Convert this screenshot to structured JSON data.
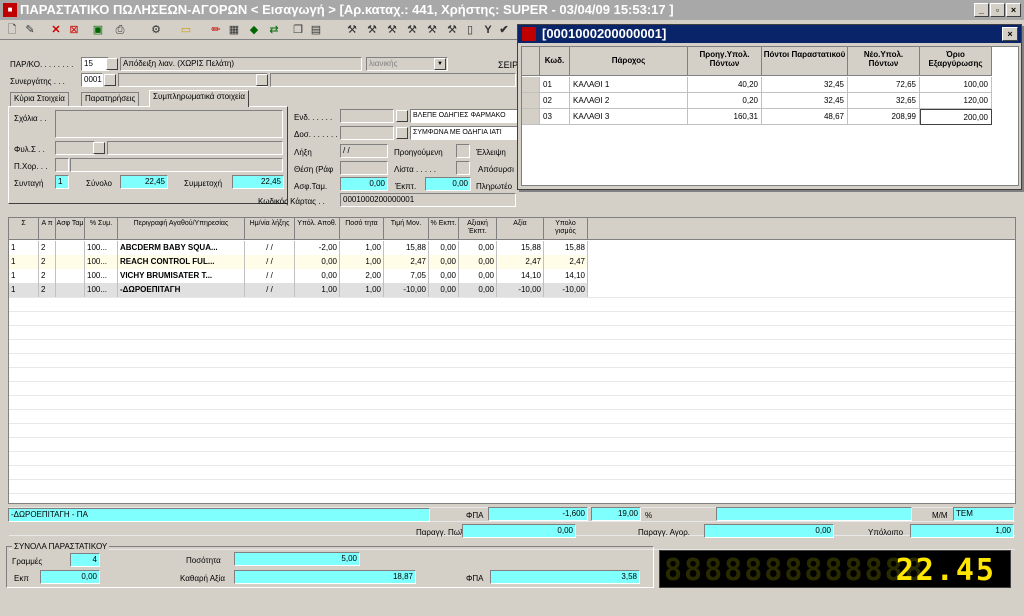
{
  "window": {
    "title": "ΠΑΡΑΣΤΑΤΙΚΟ ΠΩΛΗΣΕΩΝ-ΑΓΟΡΩΝ < Εισαγωγή > [Αρ.καταχ.: 441, Χρήστης: SUPER - 03/04/09 15:53:17 ]"
  },
  "toolbar": {
    "icons": [
      "new-icon",
      "open-icon",
      "delete-icon",
      "cancel-icon",
      "save-icon",
      "print-icon",
      "tools-icon",
      "folder-icon",
      "edit-icon",
      "calc-icon",
      "money-icon",
      "transfer-icon",
      "copy-icon",
      "calc2-icon",
      "hammer-icon",
      "check-icon"
    ],
    "y_label": "Y"
  },
  "header": {
    "par_label": "ΠΑΡ/ΚΟ. . . . . . . .",
    "par_code": "15",
    "par_desc": "Απόδειξη λιαν. (ΧΩΡΙΣ Πελάτη)",
    "par_type": "λιανικής",
    "partner_label": "Συνεργάτης . . .",
    "partner_code": "0001",
    "seira_label": "ΣΕΙΡΑ"
  },
  "tabs": [
    "Κύρια Στοιχεία",
    "Παρατηρήσεις",
    "Συμπληρωματικά στοιχεία"
  ],
  "left_panel": {
    "sxolia": "Σχόλια . .",
    "fyl": "Φυλ.Σ . .",
    "pxor": "Π.Χορ. . .",
    "syntagi_label": "Συνταγή",
    "syntagi": "1",
    "synolo_label": "Σύνολο",
    "synolo": "22,45",
    "symmetoxi_label": "Συμμετοχή",
    "symmetoxi": "22,45"
  },
  "mid_panel": {
    "end_label": "Ενδ. . . . . .",
    "end_text": "ΒΛΕΠΕ ΟΔΗΓΙΕΣ ΦΑΡΜΑΚΟ",
    "dos_label": "Δοσ. . . . . . .",
    "dos_text": "ΣΥΜΦΩΝΑ ΜΕ ΟΔΗΓΙΑ ΙΑΤΙ",
    "lixi_label": "Λήξη",
    "lixi": " / / ",
    "thesi_label": "Θέση (Ράφ",
    "asf_label": "Ασφ.Ταμ.",
    "asf": "0,00",
    "ekpt_label": "Έκπτ.",
    "ekpt": "0,00",
    "prog_label": "Προηγούμενη",
    "lista_label": "Λίστα . . . . .",
    "elleipsi_label": "Έλλειψη",
    "aposyrsi_label": "Απόσυρσι",
    "pliroteo_label": "Πληρωτέο",
    "card_label": "Κωδικός Κάρτας . .",
    "card": "0001000200000001"
  },
  "grid": {
    "headers": [
      "Σ",
      "Α π",
      "Ασφ Ταμ",
      "% Συμ.",
      "Περιγραφή Αγαθού/Υπηρεσίας",
      "Ημ/νία λήξης",
      "Υπόλ. Αποθ.",
      "Ποσό τητα",
      "Τιμή Μον.",
      "% Εκπτ.",
      "Αξιακή Έκπτ.",
      "Αξία",
      "Υπολο γισμός"
    ],
    "rows": [
      [
        "1",
        "2",
        "",
        "100...",
        "ABCDERM BABY SQUA...",
        "/ /",
        "-2,00",
        "1,00",
        "15,88",
        "0,00",
        "0,00",
        "15,88",
        "15,88"
      ],
      [
        "1",
        "2",
        "",
        "100...",
        "REACH CONTROL FUL...",
        "/ /",
        "0,00",
        "1,00",
        "2,47",
        "0,00",
        "0,00",
        "2,47",
        "2,47"
      ],
      [
        "1",
        "2",
        "",
        "100...",
        "VICHY BRUMISATER T...",
        "/ /",
        "0,00",
        "2,00",
        "7,05",
        "0,00",
        "0,00",
        "14,10",
        "14,10"
      ],
      [
        "1",
        "2",
        "",
        "100...",
        "-ΔΩΡΟΕΠΙΤΑΓΗ",
        "/ /",
        "1,00",
        "1,00",
        "-10,00",
        "0,00",
        "0,00",
        "-10,00",
        "-10,00"
      ]
    ]
  },
  "footer": {
    "desc": "-ΔΩΡΟΕΠΙΤΑΓΗ - ΠΑ",
    "fpa_label": "ΦΠΑ",
    "fpa": "-1,600",
    "fpa_pct": "19,00",
    "pct_sign": "%",
    "mm_label": "Μ/Μ",
    "mm": "TEM",
    "parag_pol_label": "Παραγγ. Πωλ.",
    "parag_pol": "0,00",
    "parag_agor_label": "Παραγγ. Αγορ.",
    "parag_agor": "0,00",
    "ypoloipo_label": "Υπόλοιπο",
    "ypoloipo": "1,00"
  },
  "totals": {
    "group_label": "ΣΥΝΟΛΑ ΠΑΡΑΣΤΑΤΙΚΟΥ",
    "grammes_label": "Γραμμές",
    "grammes": "4",
    "posotita_label": "Ποσότητα",
    "posotita": "5,00",
    "ekpt_label": "Εκπ",
    "ekpt": "0,00",
    "kathari_label": "Καθαρή Αξία",
    "kathari": "18,87",
    "fpa_label": "ΦΠΑ",
    "fpa": "3,58",
    "display": "22.45"
  },
  "popup": {
    "title": "[0001000200000001]",
    "headers": [
      "Κωδ.",
      "Πάροχος",
      "Προηγ.Υπολ. Πόντων",
      "Πόντοι Παραστατικού",
      "Νέο.Υπολ. Πόντων",
      "Όριο Εξαργύρωσης"
    ],
    "rows": [
      [
        "01",
        "ΚΑΛΑΘΙ 1",
        "40,20",
        "32,45",
        "72,65",
        "100,00"
      ],
      [
        "02",
        "ΚΑΛΑΘΙ 2",
        "0,20",
        "32,45",
        "32,65",
        "120,00"
      ],
      [
        "03",
        "ΚΑΛΑΘΙ 3",
        "160,31",
        "48,67",
        "208,99",
        "200,00"
      ]
    ]
  }
}
